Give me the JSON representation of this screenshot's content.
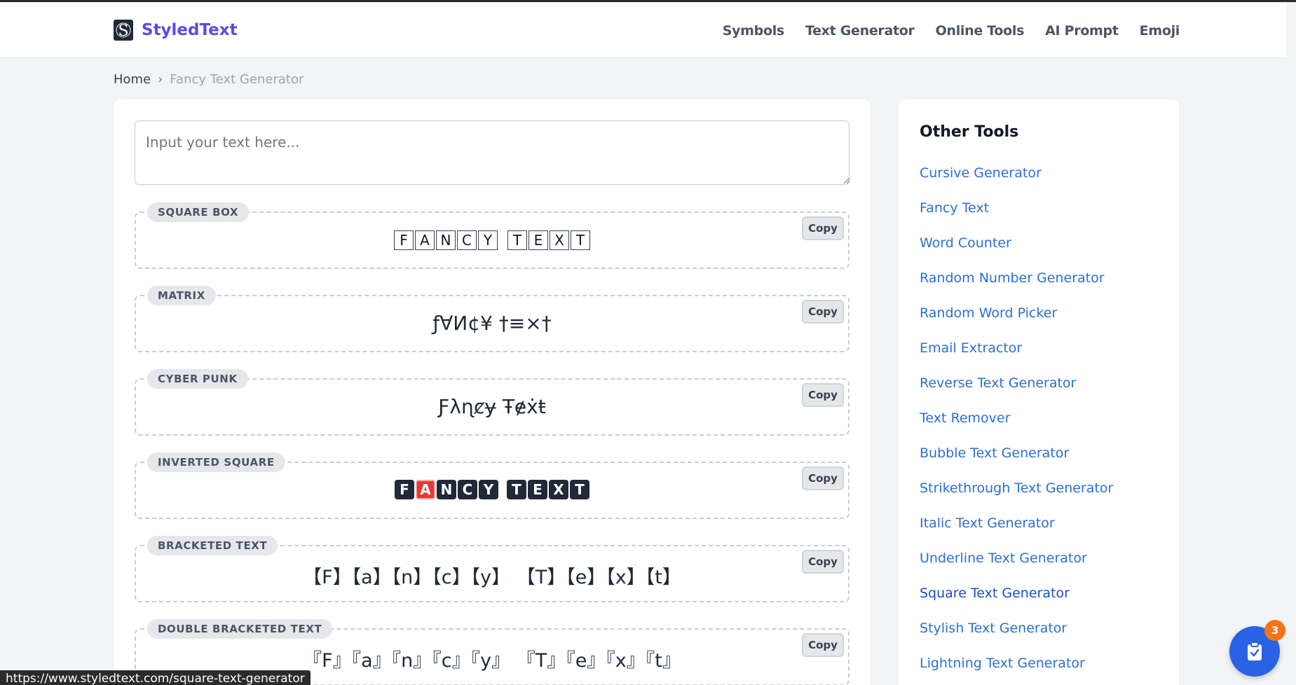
{
  "brand": {
    "name": "StyledText"
  },
  "nav": [
    "Symbols",
    "Text Generator",
    "Online Tools",
    "AI Prompt",
    "Emoji"
  ],
  "breadcrumb": {
    "home": "Home",
    "separator": "›",
    "current": "Fancy Text Generator"
  },
  "input": {
    "placeholder": "Input your text here...",
    "value": ""
  },
  "copy_label": "Copy",
  "styles": [
    {
      "label": "SQUARE BOX",
      "chars": [
        "F",
        "A",
        "N",
        "C",
        "Y",
        " ",
        "T",
        "E",
        "X",
        "T"
      ]
    },
    {
      "label": "MATRIX",
      "text": "ƒ∀Ͷ¢¥ †≡×†"
    },
    {
      "label": "CYBER PUNK",
      "text": "Ƒλɳȼɏ Ŧɇẋŧ"
    },
    {
      "label": "INVERTED SQUARE",
      "chars": [
        "F",
        "A",
        "N",
        "C",
        "Y",
        " ",
        "T",
        "E",
        "X",
        "T"
      ],
      "highlighted_index": 1
    },
    {
      "label": "BRACKETED TEXT",
      "text": "【F】【a】【n】【c】【y】 【T】【e】【x】【t】"
    },
    {
      "label": "DOUBLE BRACKETED TEXT",
      "text": "『F』『a』『n』『c』『y』 『T』『e』『x』『t』"
    }
  ],
  "sidebar": {
    "title": "Other Tools",
    "items": [
      "Cursive Generator",
      "Fancy Text",
      "Word Counter",
      "Random Number Generator",
      "Random Word Picker",
      "Email Extractor",
      "Reverse Text Generator",
      "Text Remover",
      "Bubble Text Generator",
      "Strikethrough Text Generator",
      "Italic Text Generator",
      "Underline Text Generator",
      "Square Text Generator",
      "Stylish Text Generator",
      "Lightning Text Generator"
    ],
    "hovered_index": 12
  },
  "fab": {
    "badge": "3",
    "icon": "clipboard-icon"
  },
  "status_url": "https://www.styledtext.com/square-text-generator",
  "colors": {
    "brand": "#5b4ce0",
    "link": "#2b6fd6",
    "fab": "#2a62e4",
    "badge": "#f97316",
    "highlight": "#e53935"
  }
}
